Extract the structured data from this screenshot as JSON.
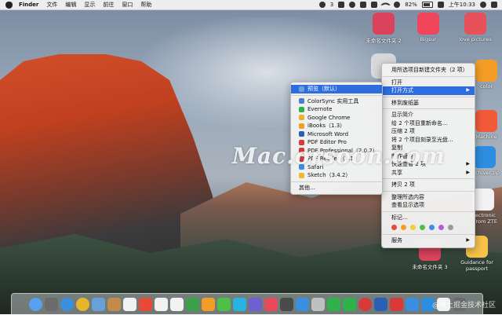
{
  "menubar": {
    "app": "Finder",
    "items": [
      "文件",
      "编辑",
      "显示",
      "前往",
      "窗口",
      "帮助"
    ],
    "wechat_badge": "3",
    "battery": "82%",
    "clock": "上午10:33"
  },
  "desktop_icons": [
    {
      "label": "未命名文件夹 2",
      "color": "#d9435b"
    },
    {
      "label": "Bigsur",
      "color": "#f0455a"
    },
    {
      "label": "love pictures",
      "color": "#e8505a"
    },
    {
      "label": "color",
      "color": "#f39c26"
    },
    {
      "label": "Machine",
      "color": "#f25a3a"
    },
    {
      "label": "Archiver.zip",
      "color": "#2d8de0"
    },
    {
      "label": "Electronic ...from ZTE",
      "color": "#f2f2f2"
    },
    {
      "label": "未命名文件夹 3",
      "color": "#d9435b"
    },
    {
      "label": "Guidance for passport",
      "color": "#f7c24a"
    }
  ],
  "context_menu": {
    "items": [
      {
        "label": "用所选项目新建文件夹（2 项）"
      },
      {
        "sep": true
      },
      {
        "label": "打开"
      },
      {
        "label": "打开方式",
        "submenu": true
      },
      {
        "sep": true
      },
      {
        "label": "移到废纸篓"
      },
      {
        "sep": true
      },
      {
        "label": "显示简介"
      },
      {
        "label": "给 2 个项目重新命名…"
      },
      {
        "label": "压缩 2 项"
      },
      {
        "label": "将 2 个项目刻录至光盘…"
      },
      {
        "label": "复制"
      },
      {
        "label": "制作替身"
      },
      {
        "label": "快速查看 2 项",
        "submenu": true
      },
      {
        "label": "共享",
        "submenu": true
      },
      {
        "sep": true
      },
      {
        "label": "拷贝 2 项"
      },
      {
        "sep": true
      },
      {
        "label": "整理所选内容"
      },
      {
        "label": "查看显示选项"
      },
      {
        "sep": true
      },
      {
        "label": "标记…"
      }
    ],
    "tag_colors": [
      "#e8493f",
      "#f39c26",
      "#f5cf2b",
      "#4fbf4a",
      "#3d8de6",
      "#b05fd4",
      "#9b9b9b"
    ],
    "services": "服务"
  },
  "open_with_submenu": {
    "default": "预览（默认）",
    "apps": [
      {
        "label": "ColorSync 实用工具",
        "color": "#4a7fd4"
      },
      {
        "label": "Evernote",
        "color": "#2fb24a"
      },
      {
        "label": "Google Chrome",
        "color": "#e8b42a"
      },
      {
        "label": "iBooks（1.3）",
        "color": "#f39c26"
      },
      {
        "label": "Microsoft Word",
        "color": "#2b5fb4"
      },
      {
        "label": "PDF Editor Pro",
        "color": "#d83a3a"
      },
      {
        "label": "PDF Professional（2.0.2）",
        "color": "#d83a3a"
      },
      {
        "label": "PDF Reader（1.1）",
        "color": "#d83a3a"
      },
      {
        "label": "Safari",
        "color": "#3a8fe0"
      },
      {
        "label": "Sketch（3.4.2）",
        "color": "#f2b830"
      }
    ],
    "other": "其他…"
  },
  "watermark": "Mac.orsoon.com",
  "corner_watermark": "@稀土掘金技术社区",
  "dock_colors": [
    "#5aa0f0",
    "#6b6b6b",
    "#3a8fe0",
    "#e8b42a",
    "#6aa0d8",
    "#c48a4a",
    "#f2f2f2",
    "#e84a3a",
    "#f2f2f2",
    "#f2f2f2",
    "#3aa04a",
    "#f39c26",
    "#4fbf4a",
    "#2ab3e0",
    "#6f5fd0",
    "#e84a5a",
    "#4a4a4a",
    "#3a8fe0",
    "#c0c0c0",
    "#2fb24a",
    "#2fb24a",
    "#d83a3a",
    "#2b5fb4",
    "#d83a3a",
    "#3a8fe0",
    "#2b8de0",
    "#f2f2f2",
    "#6b6b6b"
  ]
}
